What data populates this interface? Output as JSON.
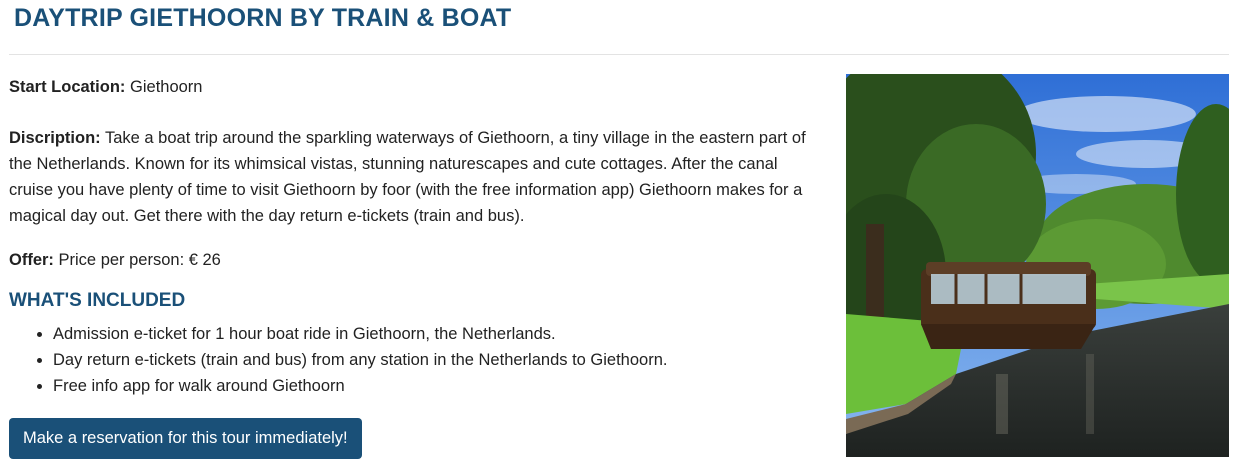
{
  "tour": {
    "title": "DAYTRIP GIETHOORN BY TRAIN & BOAT",
    "start_location_label": "Start Location:",
    "start_location_value": "Giethoorn",
    "description_label": "Discription:",
    "description_text": "Take a boat trip around the sparkling waterways of Giethoorn, a tiny village in the eastern part of the Netherlands. Known for its whimsical vistas, stunning naturescapes and cute cottages. After the canal cruise you have plenty of time to visit Giethoorn by foor (with the free information app) Giethoorn makes for a magical day out. Get there with the day return e-tickets (train and bus).",
    "offer_label": "Offer:",
    "offer_text": "Price per person: € 26"
  },
  "included": {
    "heading": "WHAT'S INCLUDED",
    "items": [
      "Admission e-ticket for 1 hour boat ride in Giethoorn, the Netherlands.",
      "Day return e-tickets (train and bus) from any station in the Netherlands to Giethoorn.",
      "Free info app for walk around Giethoorn"
    ]
  },
  "cta": {
    "label": "Make a reservation for this tour immediately!"
  },
  "colors": {
    "accent": "#1a5078",
    "button_bg": "#1a5078",
    "button_text": "#ffffff"
  },
  "photo": {
    "icon": "canal-boat-photo"
  }
}
